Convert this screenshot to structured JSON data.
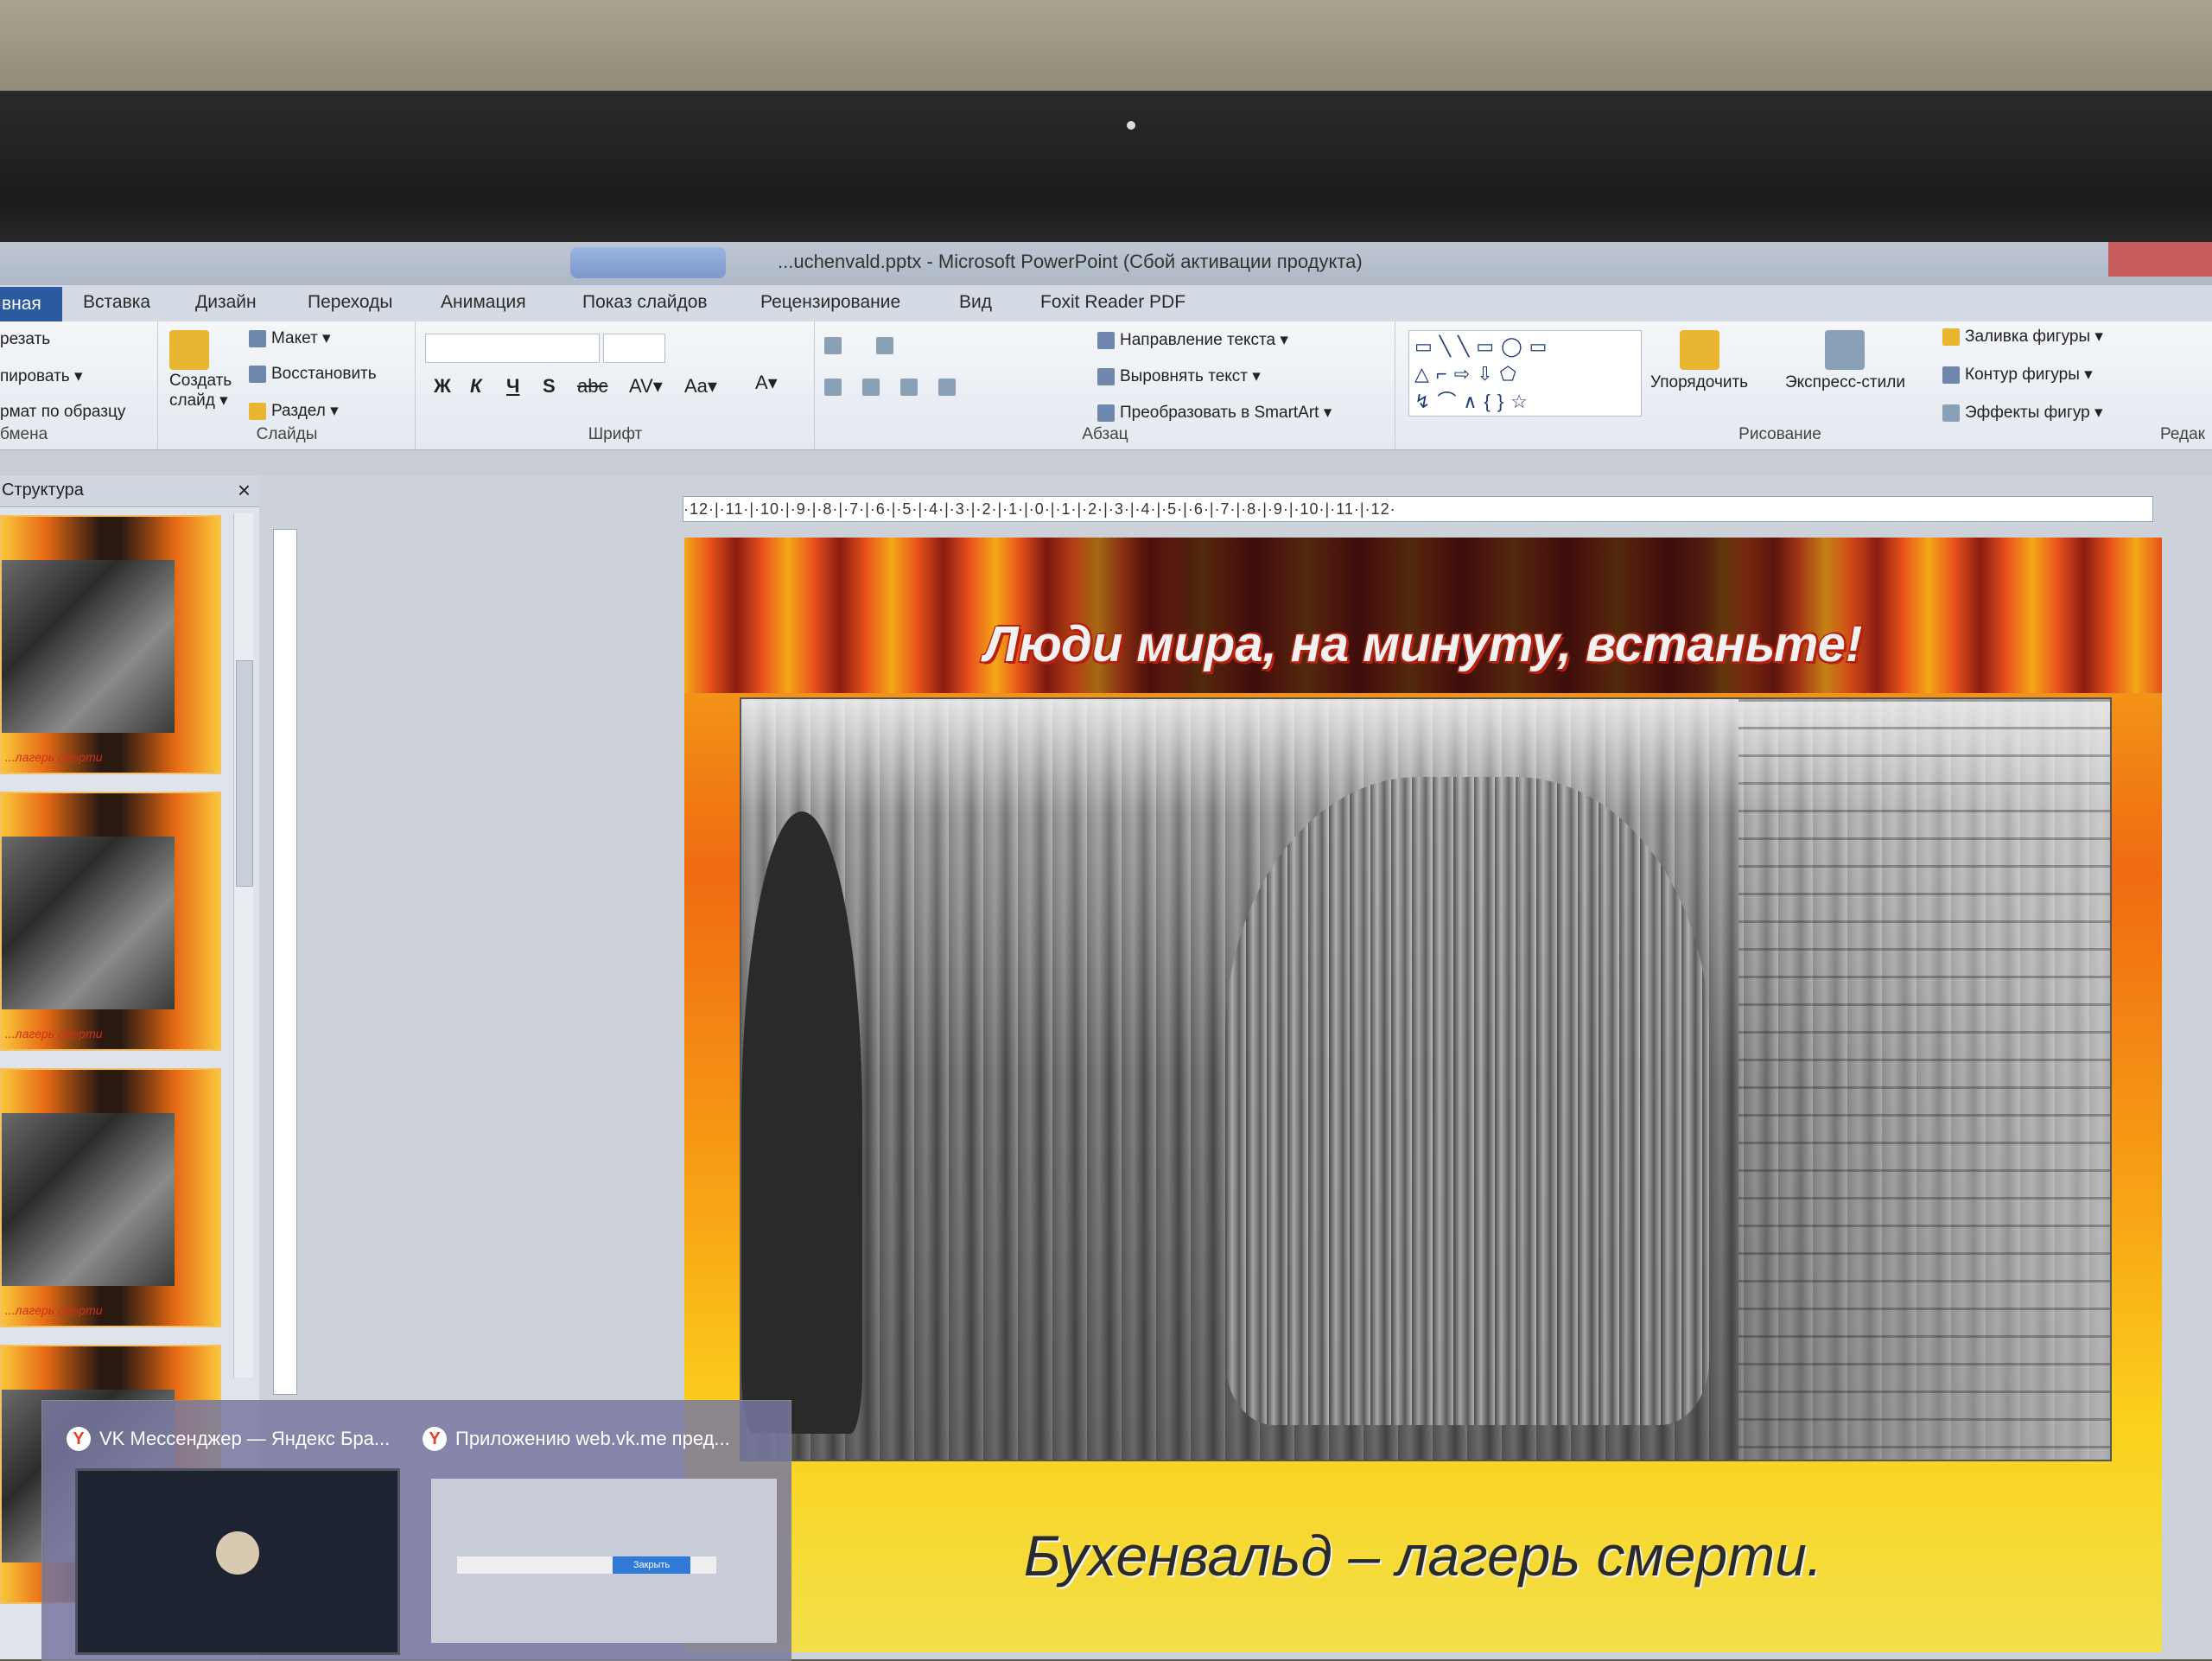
{
  "window": {
    "title": "...uchenvald.pptx - Microsoft PowerPoint (Сбой активации продукта)"
  },
  "tabs": [
    {
      "label": "вная"
    },
    {
      "label": "Вставка"
    },
    {
      "label": "Дизайн"
    },
    {
      "label": "Переходы"
    },
    {
      "label": "Анимация"
    },
    {
      "label": "Показ слайдов"
    },
    {
      "label": "Рецензирование"
    },
    {
      "label": "Вид"
    },
    {
      "label": "Foxit Reader PDF"
    }
  ],
  "ribbon": {
    "clipboard": {
      "cut": "резать",
      "copy": "пировать ▾",
      "format_painter": "рмат по образцу",
      "label": "бмена"
    },
    "slides": {
      "new_slide": "Создать слайд ▾",
      "layout": "Макет ▾",
      "reset": "Восстановить",
      "section": "Раздел ▾",
      "label": "Слайды"
    },
    "font": {
      "buttons": [
        "Ж",
        "К",
        "Ч",
        "S",
        "abc",
        "AV▾",
        "Aa▾",
        "A▾"
      ],
      "label": "Шрифт"
    },
    "paragraph": {
      "text_direction": "Направление текста ▾",
      "align_text": "Выровнять текст ▾",
      "smartart": "Преобразовать в SmartArt ▾",
      "label": "Абзац"
    },
    "drawing": {
      "arrange": "Упорядочить",
      "quick_styles": "Экспресс-стили",
      "fill": "Заливка фигуры ▾",
      "outline": "Контур фигуры ▾",
      "effects": "Эффекты фигур ▾",
      "label": "Рисование"
    },
    "editing": {
      "label": "Редак"
    }
  },
  "panel": {
    "title": "Структура",
    "close": "×",
    "thumbnails": [
      {
        "caption": "...лагерь смерти"
      },
      {
        "caption": "...лагерь смерти"
      },
      {
        "caption": "...лагерь смерти"
      },
      {
        "caption": ""
      }
    ]
  },
  "ruler": {
    "horizontal": "·12·|·11·|·10·|·9·|·8·|·7·|·6·|·5·|·4·|·3·|·2·|·1·|·0·|·1·|·2·|·3·|·4·|·5·|·6·|·7·|·8·|·9·|·10·|·11·|·12·"
  },
  "slide": {
    "title": "Люди мира, на минуту, встаньте!",
    "subtitle": "Бухенвальд – лагерь смерти."
  },
  "taskbar_preview": {
    "items": [
      {
        "label": "VK Мессенджер — Яндекс Бра..."
      },
      {
        "label": "Приложению web.vk.me пред..."
      }
    ],
    "button_text": "Закрыть"
  },
  "colors": {
    "title_text": "#f2f2f2",
    "title_outline": "#b6200f",
    "file_tab": "#2c5aa0"
  }
}
